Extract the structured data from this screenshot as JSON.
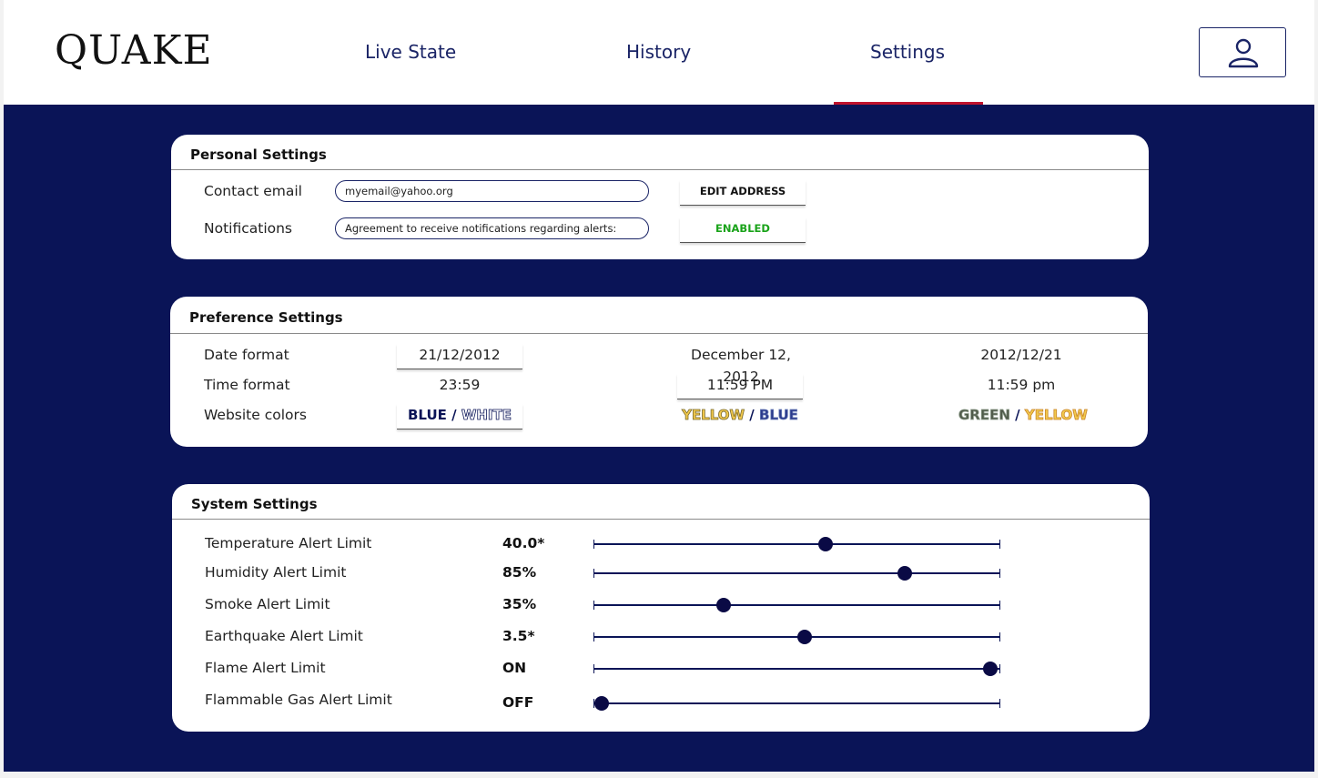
{
  "app": {
    "logo": "QUAKE"
  },
  "nav": {
    "tabs": [
      {
        "label": "Live State"
      },
      {
        "label": "History"
      },
      {
        "label": "Settings",
        "active": true
      }
    ],
    "profile_icon": "user-icon"
  },
  "colors": {
    "background": "#0a1457",
    "active_tab_underline": "#c0122c",
    "enabled": "#1aa31a"
  },
  "personal": {
    "title": "Personal Settings",
    "email_label": "Contact email",
    "email_value": "myemail@yahoo.org",
    "edit_label": "EDIT ADDRESS",
    "notifications_label": "Notifications",
    "notifications_value": "Agreement to receive notifications regarding alerts:",
    "notifications_status": "ENABLED"
  },
  "preference": {
    "title": "Preference Settings",
    "date_label": "Date format",
    "date_options": [
      "21/12/2012",
      "December 12, 2012",
      "2012/12/21"
    ],
    "date_selected": 0,
    "time_label": "Time format",
    "time_options": [
      "23:59",
      "11:59 PM",
      "11:59 pm"
    ],
    "time_selected": 1,
    "colors_label": "Website colors",
    "color_options": [
      {
        "first": "BLUE",
        "sep": " / ",
        "second": "WHITE"
      },
      {
        "first": "YELLOW",
        "sep": " / ",
        "second": "BLUE"
      },
      {
        "first": "GREEN",
        "sep": " / ",
        "second": "YELLOW"
      }
    ],
    "color_selected": 0
  },
  "system": {
    "title": "System Settings",
    "sliders": [
      {
        "label": "Temperature Alert Limit",
        "value": "40.0*",
        "level": 0.57
      },
      {
        "label": "Humidity Alert Limit",
        "value": "85%",
        "level": 0.765
      },
      {
        "label": "Smoke Alert Limit",
        "value": "35%",
        "level": 0.32
      },
      {
        "label": "Earthquake Alert Limit",
        "value": "3.5*",
        "level": 0.52
      },
      {
        "label": "Flame Alert Limit",
        "value": "ON",
        "level": 0.975
      },
      {
        "label": "Flammable Gas Alert Limit",
        "value": "OFF",
        "level": 0.02
      }
    ]
  }
}
